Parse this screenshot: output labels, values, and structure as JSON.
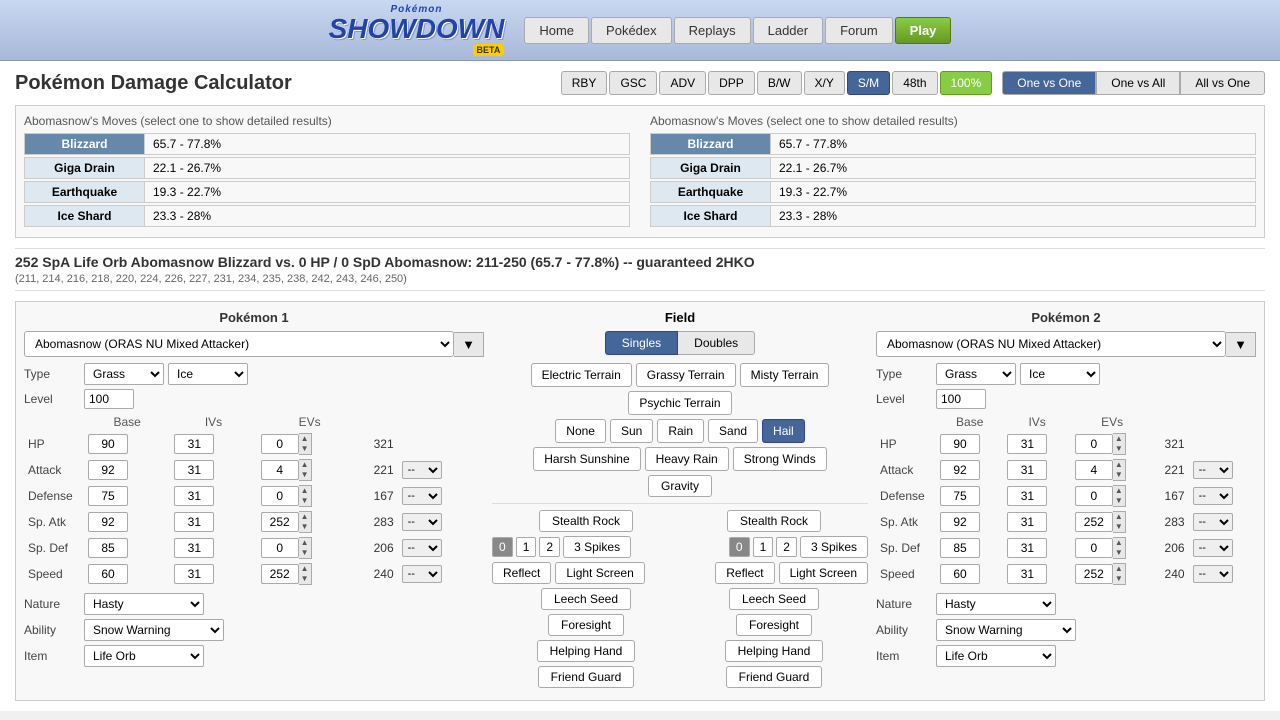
{
  "header": {
    "logo_main": "Pokémon",
    "logo_sub": "SHOWDOWN",
    "logo_beta": "BETA",
    "nav": [
      "Home",
      "Pokédex",
      "Replays",
      "Ladder",
      "Forum",
      "Play"
    ]
  },
  "title": "Pokémon Damage Calculator",
  "gen_buttons": [
    "RBY",
    "GSC",
    "ADV",
    "DPP",
    "B/W",
    "X/Y",
    "S/M",
    "48th",
    "100%"
  ],
  "mode_buttons": [
    "One vs One",
    "One vs All",
    "All vs One"
  ],
  "moves_label": "Abomasnow's Moves (select one to show detailed results)",
  "moves1": [
    {
      "name": "Blizzard",
      "pct": "65.7 - 77.8%",
      "active": true
    },
    {
      "name": "Giga Drain",
      "pct": "22.1 - 26.7%"
    },
    {
      "name": "Earthquake",
      "pct": "19.3 - 22.7%"
    },
    {
      "name": "Ice Shard",
      "pct": "23.3 - 28%"
    }
  ],
  "moves2": [
    {
      "name": "Blizzard",
      "pct": "65.7 - 77.8%",
      "active": true
    },
    {
      "name": "Giga Drain",
      "pct": "22.1 - 26.7%"
    },
    {
      "name": "Earthquake",
      "pct": "19.3 - 22.7%"
    },
    {
      "name": "Ice Shard",
      "pct": "23.3 - 28%"
    }
  ],
  "damage_result": {
    "main": "252 SpA Life Orb Abomasnow Blizzard vs. 0 HP / 0 SpD Abomasnow: 211-250 (65.7 - 77.8%) -- guaranteed 2HKO",
    "rolls": "(211, 214, 216, 218, 220, 224, 226, 227, 231, 234, 235, 238, 242, 243, 246, 250)"
  },
  "pokemon1": {
    "panel_title": "Pokémon 1",
    "select_value": "Abomasnow (ORAS NU Mixed Attacker)",
    "type1": "Grass",
    "type2": "Ice",
    "level": "100",
    "stats": [
      {
        "name": "HP",
        "base": "90",
        "ivs": "31",
        "evs": "0",
        "total": "321"
      },
      {
        "name": "Attack",
        "base": "92",
        "ivs": "31",
        "evs": "4",
        "total": "221"
      },
      {
        "name": "Defense",
        "base": "75",
        "ivs": "31",
        "evs": "0",
        "total": "167"
      },
      {
        "name": "Sp. Atk",
        "base": "92",
        "ivs": "31",
        "evs": "252",
        "total": "283"
      },
      {
        "name": "Sp. Def",
        "base": "85",
        "ivs": "31",
        "evs": "0",
        "total": "206"
      },
      {
        "name": "Speed",
        "base": "60",
        "ivs": "31",
        "evs": "252",
        "total": "240"
      }
    ],
    "nature": "Hasty",
    "ability": "Snow Warning",
    "item": "Life Orb"
  },
  "pokemon2": {
    "panel_title": "Pokémon 2",
    "select_value": "Abomasnow (ORAS NU Mixed Attacker)",
    "type1": "Grass",
    "type2": "Ice",
    "level": "100",
    "stats": [
      {
        "name": "HP",
        "base": "90",
        "ivs": "31",
        "evs": "0",
        "total": "321"
      },
      {
        "name": "Attack",
        "base": "92",
        "ivs": "31",
        "evs": "4",
        "total": "221"
      },
      {
        "name": "Defense",
        "base": "75",
        "ivs": "31",
        "evs": "0",
        "total": "167"
      },
      {
        "name": "Sp. Atk",
        "base": "92",
        "ivs": "31",
        "evs": "252",
        "total": "283"
      },
      {
        "name": "Sp. Def",
        "base": "85",
        "ivs": "31",
        "evs": "0",
        "total": "206"
      },
      {
        "name": "Speed",
        "base": "60",
        "ivs": "31",
        "evs": "252",
        "total": "240"
      }
    ],
    "nature": "Hasty",
    "ability": "Snow Warning",
    "item": "Life Orb"
  },
  "field": {
    "panel_title": "Field",
    "terrains": [
      "Electric Terrain",
      "Grassy Terrain",
      "Misty Terrain",
      "Psychic Terrain"
    ],
    "weathers": [
      "None",
      "Sun",
      "Rain",
      "Sand",
      "Hail"
    ],
    "active_weather": "Hail",
    "conditions": [
      "Harsh Sunshine",
      "Heavy Rain",
      "Strong Winds"
    ],
    "gravity": "Gravity",
    "singles_doubles": [
      "Singles",
      "Doubles"
    ],
    "active_tab": "Singles",
    "spikes_p1": {
      "nums": [
        "0",
        "1",
        "2"
      ],
      "active": "0",
      "label": "3 Spikes"
    },
    "spikes_p2": {
      "nums": [
        "0",
        "1",
        "2"
      ],
      "active": "0",
      "label": "3 Spikes"
    },
    "stealth_rock": "Stealth Rock",
    "reflect": "Reflect",
    "light_screen": "Light Screen",
    "leech_seed": "Leech Seed",
    "foresight": "Foresight",
    "helping_hand": "Helping Hand",
    "friend_guard": "Friend Guard"
  }
}
